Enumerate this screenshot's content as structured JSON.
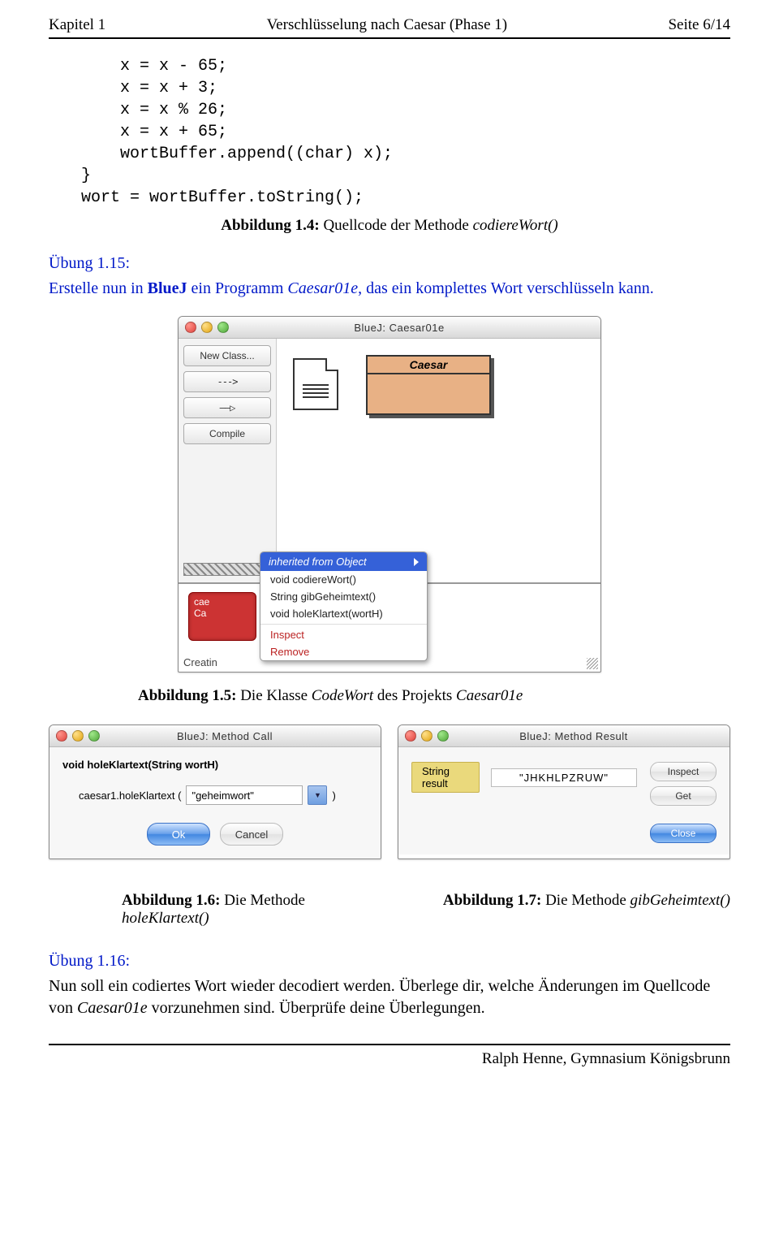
{
  "header": {
    "chapter": "Kapitel 1",
    "title": "Verschlüsselung nach Caesar (Phase 1)",
    "page": "Seite 6/14"
  },
  "code": "    x = x - 65;\n    x = x + 3;\n    x = x % 26;\n    x = x + 65;\n    wortBuffer.append((char) x);\n}\nwort = wortBuffer.toString();",
  "caption14": {
    "label": "Abbildung 1.4:",
    "text_a": " Quellcode der Methode ",
    "italic": "codiereWort()"
  },
  "ex15": {
    "heading": "Übung 1.15:",
    "pre": "Erstelle nun in ",
    "bluej": "BlueJ",
    "mid": " ein Programm ",
    "proj": "Caesar01e",
    "post": ", das ein komplettes Wort verschlüsseln kann."
  },
  "bluej_main": {
    "title": "BlueJ:  Caesar01e",
    "sidebar": {
      "new_class": "New Class...",
      "dashed": "--->",
      "solid": "——▷",
      "compile": "Compile"
    },
    "class_name": "Caesar",
    "menu": {
      "header": "inherited from Object",
      "items": [
        "void codiereWort()",
        "String gibGeheimtext()",
        "void holeKlartext(wortH)"
      ],
      "inspect": "Inspect",
      "remove": "Remove"
    },
    "obj_line1": "cae",
    "obj_line2": "Ca",
    "status": "Creatin"
  },
  "caption15": {
    "label": "Abbildung 1.5:",
    "text_a": " Die Klasse ",
    "italic1": "CodeWort",
    "text_b": " des Projekts ",
    "italic2": "Caesar01e"
  },
  "method_call": {
    "title": "BlueJ:  Method Call",
    "signature": "void holeKlartext(String wortH)",
    "call_prefix": "caesar1.holeKlartext (",
    "arg": "\"geheimwort\"",
    "call_suffix": ")",
    "ok": "Ok",
    "cancel": "Cancel"
  },
  "method_result": {
    "title": "BlueJ:  Method Result",
    "label": "String result",
    "value": "\"JHKHLPZRUW\"",
    "inspect": "Inspect",
    "get": "Get",
    "close": "Close"
  },
  "caption16": {
    "label": "Abbildung 1.6:",
    "text": " Die Methode",
    "italic": "holeKlartext()"
  },
  "caption17": {
    "label": "Abbildung 1.7:",
    "text": " Die Methode ",
    "italic": "gibGeheimtext()"
  },
  "ex16": {
    "heading": "Übung 1.16:",
    "line1": "Nun soll ein codiertes Wort wieder decodiert werden. Überlege dir, welche Änderungen im Quellcode von ",
    "proj": "Caesar01e",
    "line2": " vorzunehmen sind. Überprüfe deine Überlegungen."
  },
  "footer": "Ralph Henne, Gymnasium Königsbrunn"
}
